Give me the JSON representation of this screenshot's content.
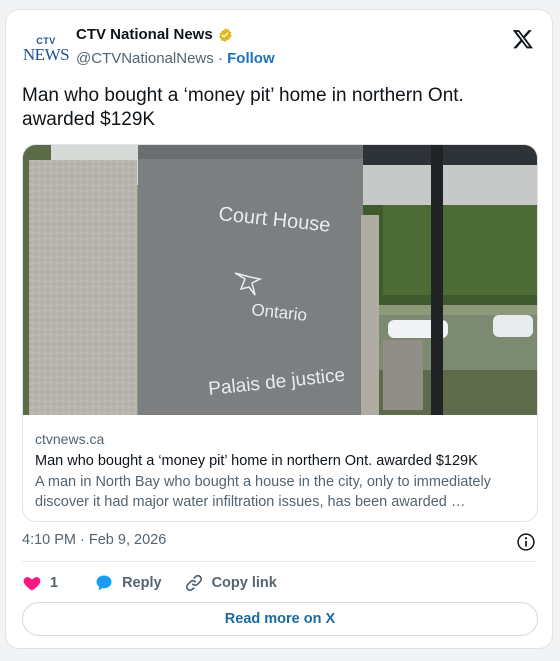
{
  "account": {
    "display_name": "CTV National News",
    "handle": "@CTVNationalNews",
    "separator": " · ",
    "follow_label": "Follow",
    "logo_text_top": "CTV",
    "logo_text_bottom": "NEWS"
  },
  "tweet": {
    "text": "Man who bought a ‘money pit’ home in northern Ont. awarded $129K",
    "timestamp": "4:10 PM · Feb 9, 2026"
  },
  "link_card": {
    "image_sign_line1": "Court House",
    "image_sign_line2": "Ontario",
    "image_sign_line3": "Palais de justice",
    "domain": "ctvnews.ca",
    "title": "Man who bought a ‘money pit’ home in northern Ont. awarded $129K",
    "description": "A man in North Bay who bought a house in the city, only to immediately discover it had major water infiltration issues, has been awarded …"
  },
  "actions": {
    "like_count": "1",
    "reply_label": "Reply",
    "copy_link_label": "Copy link",
    "read_more_label": "Read more on X"
  },
  "icons": {
    "verified": "verified-gold-badge-icon",
    "x_logo": "x-logo-icon",
    "info": "info-icon",
    "heart": "heart-icon",
    "reply": "speech-bubble-icon",
    "link": "link-icon"
  },
  "colors": {
    "heart": "#f91880",
    "reply": "#1d9bf0",
    "follow": "#1d72b8",
    "gold_badge": "#e2b719"
  }
}
